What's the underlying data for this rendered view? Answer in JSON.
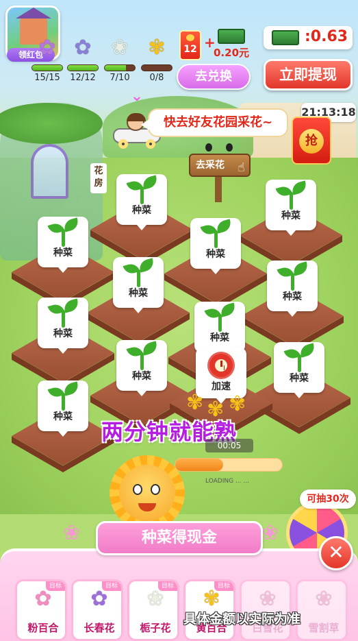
{
  "header": {
    "avatar_label": "领红包",
    "flower_stats": [
      {
        "icon": "purple-flower-icon",
        "glyph": "✿",
        "color": "#b576e0",
        "text": "15/15",
        "progress": 1.0
      },
      {
        "icon": "blue-flower-icon",
        "glyph": "✿",
        "color": "#8a7fd6",
        "text": "12/12",
        "progress": 1.0
      },
      {
        "icon": "white-flower-icon",
        "glyph": "❀",
        "color": "#e9efe1",
        "text": "7/10",
        "progress": 0.7
      },
      {
        "icon": "yellow-lily-icon",
        "glyph": "✾",
        "color": "#f6c21a",
        "text": "0/8",
        "progress": 0.0
      }
    ],
    "redpack_count": "12",
    "plus": "+",
    "cash_reward": "0.20元",
    "exchange_label": "去兑换",
    "balance": ":0.63",
    "withdraw_label": "立即提现",
    "arrow": "⌄"
  },
  "event": {
    "speech": "快去好友花园采花~",
    "timer": "21:13:18",
    "grab_label": "抢",
    "sign_label": "去采花",
    "flower_house": "花房"
  },
  "plots": [
    {
      "label": "种菜",
      "kind": "sprout"
    },
    {
      "label": "种菜",
      "kind": "sprout"
    },
    {
      "label": "种菜",
      "kind": "sprout"
    },
    {
      "label": "种菜",
      "kind": "sprout"
    },
    {
      "label": "种菜",
      "kind": "sprout"
    },
    {
      "label": "种菜",
      "kind": "sprout"
    },
    {
      "label": "种菜",
      "kind": "sprout"
    },
    {
      "label": "种菜",
      "kind": "sprout"
    },
    {
      "label": "种菜",
      "kind": "sprout"
    },
    {
      "label": "种菜",
      "kind": "sprout"
    },
    {
      "label": "加速",
      "kind": "speedup"
    },
    {
      "label": "种菜",
      "kind": "sprout"
    },
    {
      "label": "种菜",
      "kind": "sprout"
    }
  ],
  "growth": {
    "slogan": "两分钟就能熟",
    "time": "00:05",
    "progress": 0.45,
    "loading": "LOADING ...  ..."
  },
  "wheel": {
    "badge": "可抽30次"
  },
  "panel": {
    "title": "种菜得现金",
    "close": "✕",
    "seeds": [
      {
        "name": "粉百合",
        "tag": "目标",
        "glyph": "✿",
        "color": "#f28bc0",
        "dim": false
      },
      {
        "name": "长春花",
        "tag": "目标",
        "glyph": "✿",
        "color": "#9d6fd9",
        "dim": false
      },
      {
        "name": "栀子花",
        "tag": "目标",
        "glyph": "❀",
        "color": "#e9efe1",
        "dim": false
      },
      {
        "name": "黄百合",
        "tag": "目标",
        "glyph": "✾",
        "color": "#f6c21a",
        "dim": false
      },
      {
        "name": "白雪花",
        "tag": "",
        "glyph": "❀",
        "color": "#e7b3cc",
        "dim": true
      },
      {
        "name": "雪割草",
        "tag": "",
        "glyph": "❀",
        "color": "#e7b3cc",
        "dim": true
      }
    ],
    "disclaimer": "具体金额以实际为准"
  }
}
